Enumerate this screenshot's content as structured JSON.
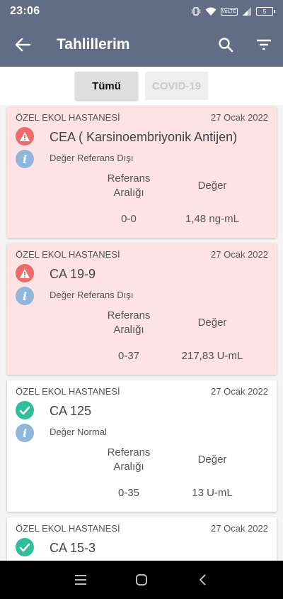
{
  "status_bar": {
    "time": "23:06",
    "volte": "VoLTE",
    "battery": "5"
  },
  "app_bar": {
    "title": "Tahlillerim"
  },
  "tabs": [
    {
      "label": "Tümü",
      "active": true
    },
    {
      "label": "COVID-19",
      "active": false
    }
  ],
  "columns": {
    "reference": "Referans Aralığı",
    "value": "Değer"
  },
  "results": [
    {
      "hospital": "ÖZEL EKOL HASTANESİ",
      "date": "27 Ocak 2022",
      "status": "alert",
      "status_icon": "warning-icon",
      "test": "CEA ( Karsinoembriyonik Antijen)",
      "note": "Değer Referans Dışı",
      "reference": "0-0",
      "value": "1,48 ng-mL"
    },
    {
      "hospital": "ÖZEL EKOL HASTANESİ",
      "date": "27 Ocak 2022",
      "status": "alert",
      "status_icon": "warning-icon",
      "test": "CA 19-9",
      "note": "Değer Referans Dışı",
      "reference": "0-37",
      "value": "217,83 U-mL"
    },
    {
      "hospital": "ÖZEL EKOL HASTANESİ",
      "date": "27 Ocak 2022",
      "status": "normal",
      "status_icon": "check-icon",
      "test": "CA 125",
      "note": "Değer Normal",
      "reference": "0-35",
      "value": "13 U-mL"
    },
    {
      "hospital": "ÖZEL EKOL HASTANESİ",
      "date": "27 Ocak 2022",
      "status": "normal",
      "status_icon": "check-icon",
      "test": "CA 15-3",
      "note": "",
      "reference": "",
      "value": ""
    }
  ],
  "info_glyph": "i",
  "colors": {
    "toolbar": "#626d85",
    "alert_card": "#fde3e3",
    "warning": "#ef6b6b",
    "ok": "#2ebf9a",
    "info": "#8fb7dd"
  }
}
